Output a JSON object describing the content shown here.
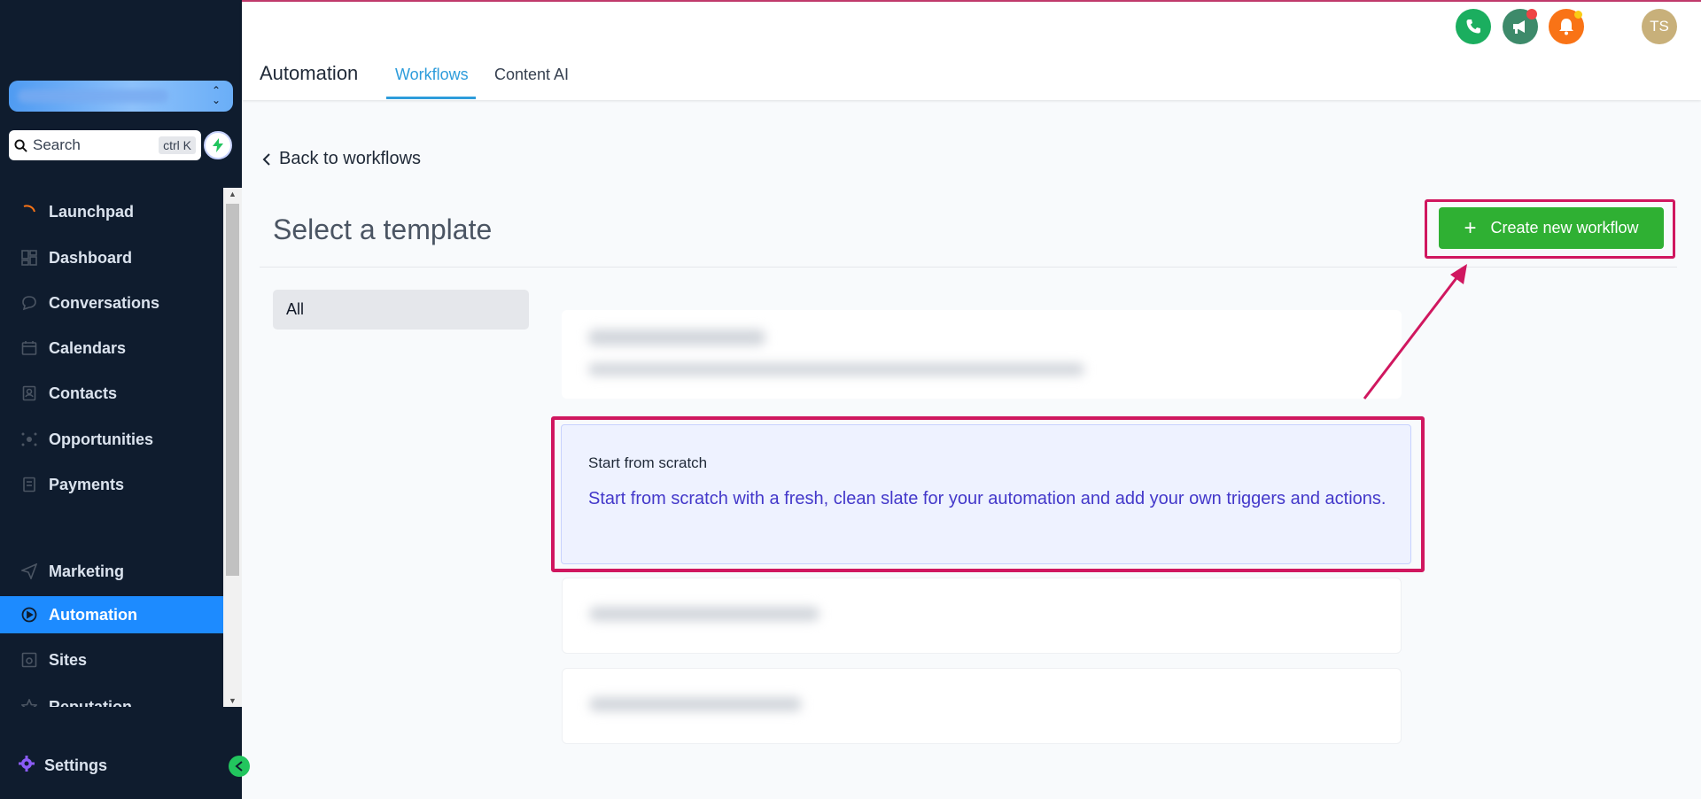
{
  "sidebar": {
    "search": {
      "label": "Search",
      "shortcut": "ctrl K"
    },
    "items": [
      {
        "label": "Launchpad",
        "icon": "launchpad-icon"
      },
      {
        "label": "Dashboard",
        "icon": "dashboard-icon"
      },
      {
        "label": "Conversations",
        "icon": "chat-icon"
      },
      {
        "label": "Calendars",
        "icon": "calendar-icon"
      },
      {
        "label": "Contacts",
        "icon": "contacts-icon"
      },
      {
        "label": "Opportunities",
        "icon": "opportunities-icon"
      },
      {
        "label": "Payments",
        "icon": "payments-icon"
      },
      {
        "label": "Marketing",
        "icon": "send-icon"
      },
      {
        "label": "Automation",
        "icon": "automation-icon",
        "active": true
      },
      {
        "label": "Sites",
        "icon": "sites-icon"
      },
      {
        "label": "Reputation",
        "icon": "star-icon"
      }
    ],
    "settings_label": "Settings"
  },
  "header": {
    "title": "Automation",
    "tabs": [
      {
        "label": "Workflows",
        "active": true
      },
      {
        "label": "Content AI"
      }
    ],
    "avatar_initials": "TS"
  },
  "main": {
    "back_label": "Back to workflows",
    "page_title": "Select a template",
    "create_button_label": "Create new workflow",
    "categories": [
      {
        "label": "All"
      }
    ],
    "scratch_card": {
      "title": "Start from scratch",
      "description": "Start from scratch with a fresh, clean slate for your automation and add your own triggers and actions."
    }
  },
  "colors": {
    "sidebar_bg": "#0f1c2e",
    "active_nav": "#1d8bff",
    "primary_green": "#2fb033",
    "highlight": "#d0175f",
    "tab_accent": "#2d9cdb"
  }
}
